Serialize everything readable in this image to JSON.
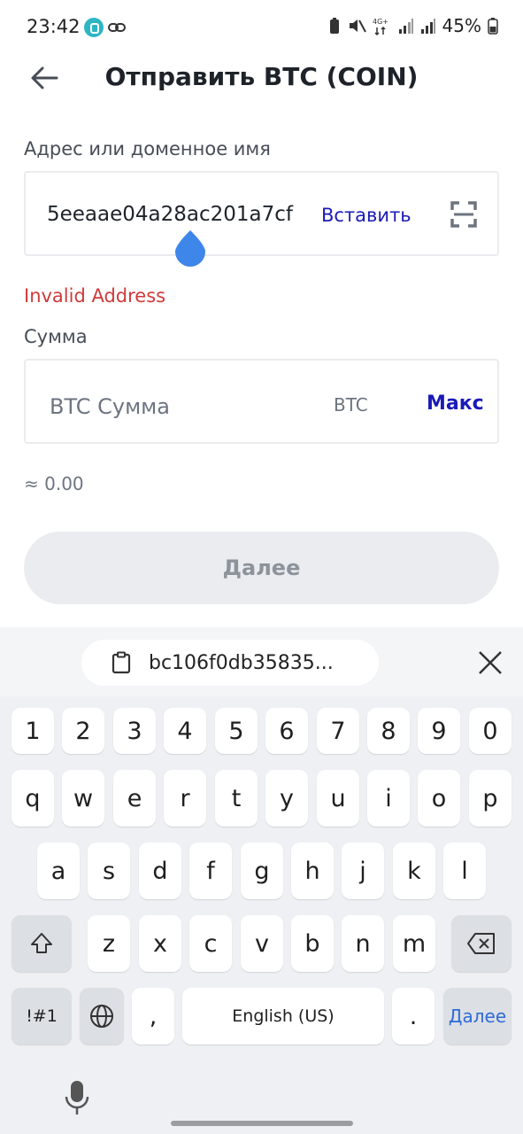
{
  "status_bar": {
    "time": "23:42",
    "battery": "45%"
  },
  "header": {
    "title": "Отправить BTC (COIN)"
  },
  "address": {
    "label": "Адрес или доменное имя",
    "value": "5eeaae04a28ac201a7cf",
    "paste_label": "Вставить",
    "error": "Invalid Address"
  },
  "amount": {
    "label": "Сумма",
    "placeholder": "BTC Сумма",
    "unit": "BTC",
    "max_label": "Макс",
    "approx": "≈ 0.00"
  },
  "next_button": {
    "label": "Далее"
  },
  "keyboard": {
    "clipboard_text": "bc106f0db35835...",
    "numbers": [
      "1",
      "2",
      "3",
      "4",
      "5",
      "6",
      "7",
      "8",
      "9",
      "0"
    ],
    "row1": [
      "q",
      "w",
      "e",
      "r",
      "t",
      "y",
      "u",
      "i",
      "o",
      "p"
    ],
    "row2": [
      "a",
      "s",
      "d",
      "f",
      "g",
      "h",
      "j",
      "k",
      "l"
    ],
    "row3": [
      "z",
      "x",
      "c",
      "v",
      "b",
      "n",
      "m"
    ],
    "sym_label": "!#1",
    "comma": ",",
    "space_label": "English (US)",
    "period": ".",
    "action_label": "Далее"
  },
  "colors": {
    "accent": "#1a1ab8",
    "error": "#cf3a3a",
    "button_bg": "#eaecef"
  }
}
